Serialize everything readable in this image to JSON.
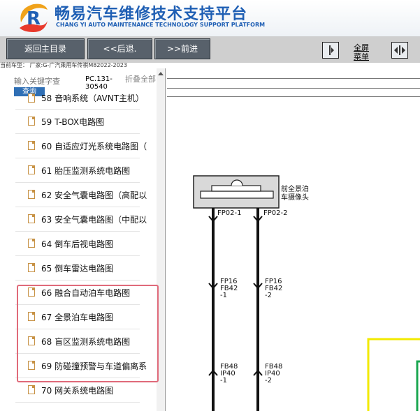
{
  "header": {
    "title_cn": "畅易汽车维修技术支持平台",
    "title_en": "CHANG YI AUTO MAINTENANCE TECHNOLOGY SUPPORT PLATFORM",
    "logo_letter": "R",
    "brand_color": "#1f5fb4"
  },
  "toolbar": {
    "home_label": "返回主目录",
    "back_label": "<<后退.",
    "forward_label": ">>前进",
    "fullscreen_label": "全屏",
    "menu_label": "菜单"
  },
  "current_model": "当前车型： 厂家:G-广汽乘用车传祺M82022-2023",
  "sidebar": {
    "search_placeholder": "输入关键字查",
    "search_button": "查询",
    "pc_code": "PC.131-30540",
    "collapse_label": "折叠全部",
    "items": [
      {
        "label": "58 音响系统（AVNT主机）"
      },
      {
        "label": "59 T-BOX电路图"
      },
      {
        "label": "60 自适应灯光系统电路图（"
      },
      {
        "label": "61 胎压监测系统电路图"
      },
      {
        "label": "62 安全气囊电路图（高配以"
      },
      {
        "label": "63 安全气囊电路图（中配以"
      },
      {
        "label": "64 倒车后视电路图"
      },
      {
        "label": "65 倒车雷达电路图"
      },
      {
        "label": "66 融合自动泊车电路图"
      },
      {
        "label": "67 全景泊车电路图"
      },
      {
        "label": "68 盲区监测系统电路图"
      },
      {
        "label": "69 防碰撞预警与车道偏离系"
      },
      {
        "label": "70 网关系统电路图"
      }
    ],
    "highlight_color": "#e06a7a"
  },
  "diagram": {
    "component_label_1": "前全景泊",
    "component_label_2": "车摄像头",
    "pin_left": "FP02-1",
    "pin_right": "FP02-2",
    "conn1_left_a": "FP16",
    "conn1_left_b": "FB42",
    "conn1_left_c": "-1",
    "conn1_right_a": "FP16",
    "conn1_right_b": "FB42",
    "conn1_right_c": "-2",
    "conn2_left_a": "FB48",
    "conn2_left_b": "IP40",
    "conn2_left_c": "-1",
    "conn2_right_a": "FB48",
    "conn2_right_b": "IP40",
    "conn2_right_c": "-2",
    "yellow_box_color": "#f2ea00",
    "green_box_color": "#1aa650"
  }
}
